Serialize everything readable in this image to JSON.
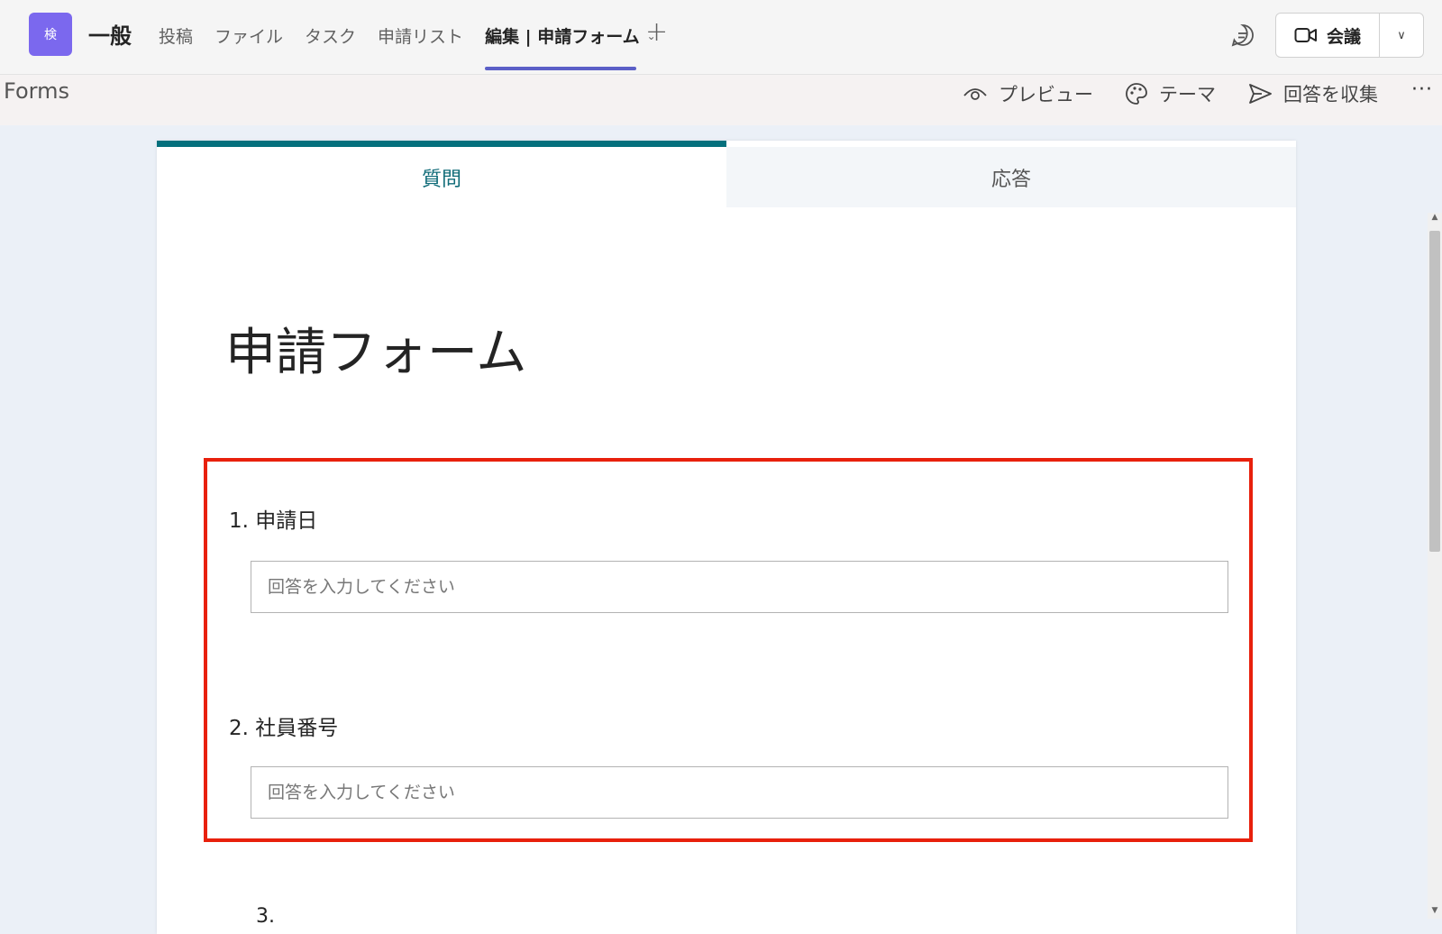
{
  "topbar": {
    "team_avatar": "検",
    "channel_name": "一般",
    "tabs": [
      {
        "label": "投稿"
      },
      {
        "label": "ファイル"
      },
      {
        "label": "タスク"
      },
      {
        "label": "申請リスト"
      },
      {
        "label": "編集 | 申請フォーム"
      }
    ],
    "add_tab": "+",
    "meet_label": "会議",
    "meet_dropdown": "∨"
  },
  "forms_bar": {
    "title": "Forms",
    "preview": "プレビュー",
    "theme": "テーマ",
    "collect": "回答を収集",
    "more": "···"
  },
  "form": {
    "tab_questions": "質問",
    "tab_responses": "応答",
    "title": "申請フォーム",
    "questions": [
      {
        "label": "1. 申請日",
        "placeholder": "回答を入力してください"
      },
      {
        "label": "2. 社員番号",
        "placeholder": "回答を入力してください"
      },
      {
        "label": "3."
      }
    ]
  },
  "colors": {
    "accent_teams": "#5b5fc7",
    "accent_forms": "#04707d",
    "highlight": "#e8200c"
  }
}
